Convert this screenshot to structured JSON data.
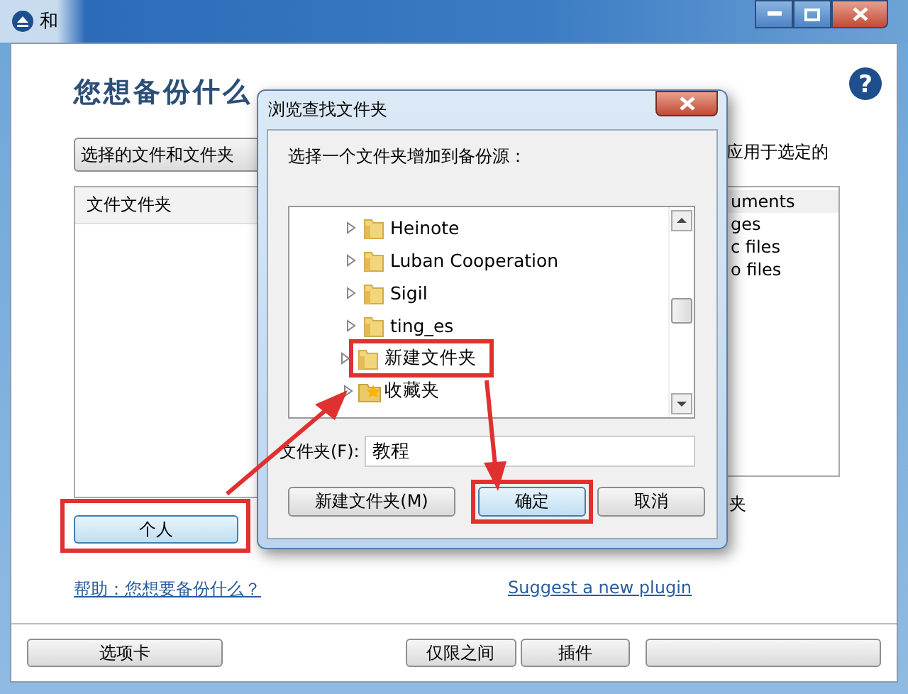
{
  "window": {
    "title": "和"
  },
  "help_glyph": "?",
  "main": {
    "heading": "您想备份什么",
    "source_dropdown": {
      "value": "选择的文件和文件夹"
    },
    "file_list": {
      "header": "文件文件夹"
    },
    "personal_button": "个人",
    "help_link": "帮助：您想要备份什么？",
    "filter": {
      "apply_text": "应用于选定的",
      "items": [
        {
          "label": "uments",
          "selected": true
        },
        {
          "label": "ges",
          "selected": false
        },
        {
          "label": "c files",
          "selected": false
        },
        {
          "label": "o files",
          "selected": false
        }
      ],
      "trailing_text": "夹"
    },
    "plugin_link": "Suggest a new plugin"
  },
  "bottom_buttons": [
    {
      "label": "选项卡"
    },
    {
      "label": "仅限之间"
    },
    {
      "label": "插件"
    }
  ],
  "dialog": {
    "title": "浏览查找文件夹",
    "prompt": "选择一个文件夹增加到备份源：",
    "tree": [
      {
        "label": "Heinote",
        "kind": "folder",
        "expanded": false
      },
      {
        "label": "Luban Cooperation",
        "kind": "folder",
        "expanded": false
      },
      {
        "label": "Sigil",
        "kind": "folder",
        "expanded": false
      },
      {
        "label": "ting_es",
        "kind": "folder",
        "expanded": false
      },
      {
        "label": "新建文件夹",
        "kind": "folder",
        "expanded": false,
        "highlighted": true
      },
      {
        "label": "收藏夹",
        "kind": "favorites",
        "expanded": false
      }
    ],
    "folder_label": "文件夹(F):",
    "folder_value": "教程",
    "buttons": [
      {
        "label": "新建文件夹(M)",
        "kind": "new-folder",
        "highlighted": false
      },
      {
        "label": "确定",
        "kind": "ok",
        "highlighted": true
      },
      {
        "label": "取消",
        "kind": "cancel",
        "highlighted": false
      }
    ]
  },
  "annotations": {
    "personal_button_highlighted": true
  }
}
